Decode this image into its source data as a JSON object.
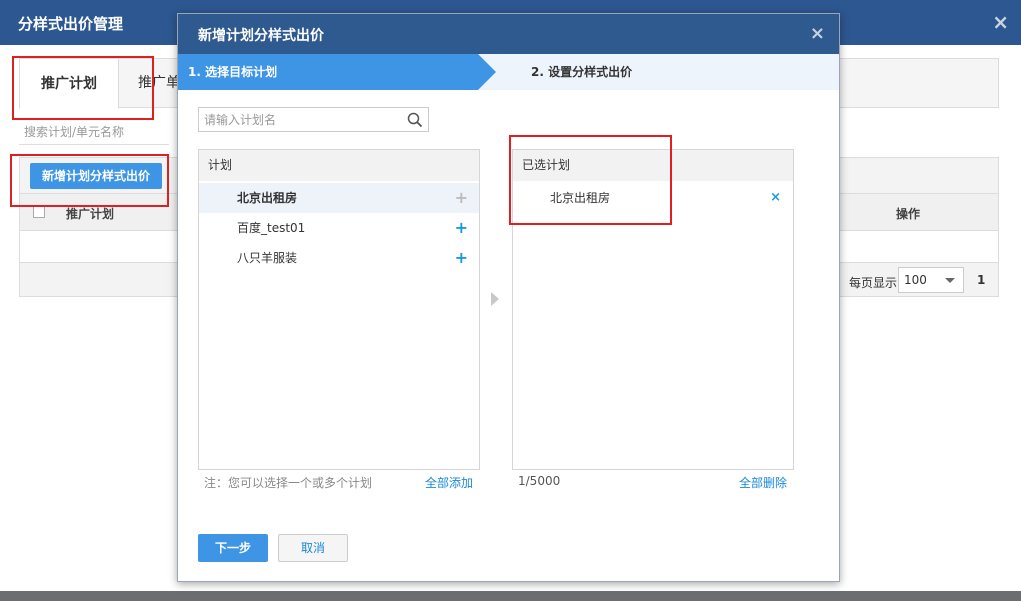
{
  "outer": {
    "title": "分样式出价管理",
    "close": "×",
    "tabs": [
      {
        "label": "推广计划"
      },
      {
        "label": "推广单"
      }
    ],
    "search_placeholder": "搜索计划/单元名称",
    "new_button": "新增计划分样式出价",
    "table": {
      "col_plan": "推广计划",
      "col_op": "操作"
    },
    "per_page_label": "每页显示",
    "per_page_value": "100",
    "page_number": "1"
  },
  "modal": {
    "title": "新增计划分样式出价",
    "close": "×",
    "steps": [
      {
        "label": "1. 选择目标计划"
      },
      {
        "label": "2. 设置分样式出价"
      }
    ],
    "search_placeholder": "请输入计划名",
    "left_panel": {
      "header": "计划",
      "items": [
        {
          "name": "北京出租房"
        },
        {
          "name": "百度_test01"
        },
        {
          "name": "八只羊服装"
        }
      ],
      "note": "注：您可以选择一个或多个计划",
      "add_all": "全部添加"
    },
    "right_panel": {
      "header": "已选计划",
      "items": [
        {
          "name": "北京出租房"
        }
      ],
      "count": "1/5000",
      "delete_all": "全部删除"
    },
    "buttons": {
      "next": "下一步",
      "cancel": "取消"
    }
  },
  "colors": {
    "header_blue": "#2d5790",
    "accent_blue": "#3e95e6",
    "link_blue": "#1a88d9",
    "annotation_red": "#e02020"
  }
}
